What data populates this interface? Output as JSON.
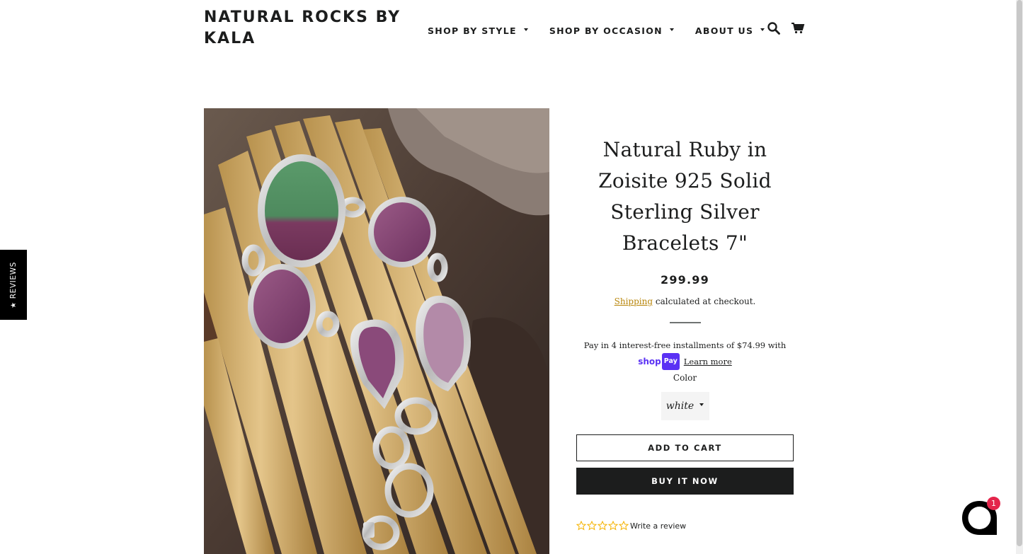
{
  "header": {
    "logo": "NATURAL ROCKS BY KALA",
    "nav": [
      {
        "label": "SHOP BY STYLE"
      },
      {
        "label": "SHOP BY OCCASION"
      },
      {
        "label": "ABOUT US"
      }
    ],
    "icons": [
      "search-icon",
      "cart-icon"
    ]
  },
  "side_tab": {
    "icon": "star-icon",
    "label": "REVIEWS"
  },
  "product": {
    "image": {
      "subject": "product-photo"
    },
    "title": "Natural Ruby in Zoisite 925 Solid Sterling Silver Bracelets 7\"",
    "price": "299.99",
    "shipping_link": "Shipping",
    "shipping_rest": " calculated at checkout.",
    "installments_text": "Pay in 4 interest-free installments of $74.99 with",
    "shoppay_brand": "shop",
    "shoppay_pay": "Pay",
    "learn_more": "Learn more",
    "color_label": "Color",
    "color_value": "white",
    "add_to_cart": "ADD TO CART",
    "buy_now": "BUY IT NOW",
    "rating_stars": 0,
    "write_review": "Write a review"
  },
  "chat": {
    "badge_count": "1",
    "icon": "chat-icon"
  },
  "colors": {
    "text": "#1c1d1d",
    "accent_link": "#b8860b",
    "shoppay": "#5a31f4",
    "button_dark": "#1c1d1d",
    "badge": "#e4254b",
    "star_outline": "#f5b301"
  }
}
